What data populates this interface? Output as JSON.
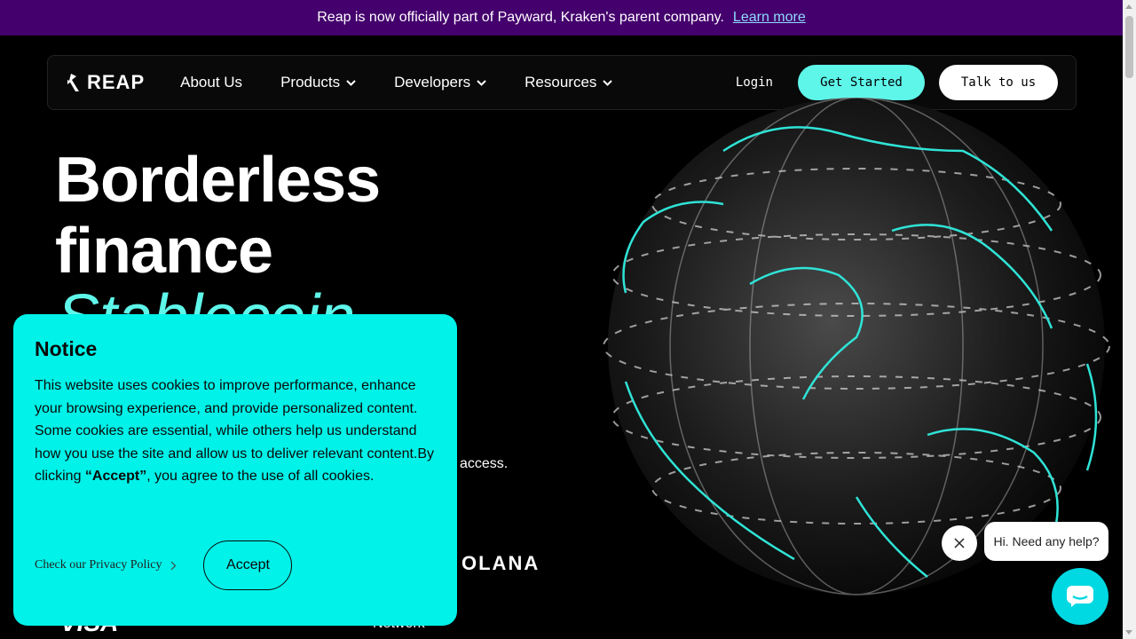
{
  "announcement": {
    "text": "Reap is now officially part of Payward, Kraken's parent company.",
    "link": "Learn more"
  },
  "nav": {
    "logo": "REAP",
    "items": [
      {
        "label": "About Us",
        "dropdown": false
      },
      {
        "label": "Products",
        "dropdown": true
      },
      {
        "label": "Developers",
        "dropdown": true
      },
      {
        "label": "Resources",
        "dropdown": true
      }
    ],
    "login": "Login",
    "get_started": "Get Started",
    "talk": "Talk to us"
  },
  "hero": {
    "line1": "Borderless",
    "line2": "finance",
    "accent": "Stablecoin",
    "subtitle_tail": "access.",
    "partners": {
      "solana": "OLANA",
      "visa": "VISA",
      "network": "Network"
    }
  },
  "cookie": {
    "title": "Notice",
    "body_pre": "This website uses cookies to improve performance, enhance your browsing experience, and provide personalized content. Some cookies are essential, while others help us understand how you use the site and allow us to deliver relevant content.By clicking ",
    "body_bold": "“Accept”",
    "body_post": ", you agree to the use of all cookies.",
    "privacy": "Check our Privacy Policy",
    "accept": "Accept"
  },
  "chat": {
    "bubble": "Hi. Need any help?"
  },
  "colors": {
    "announce_bg": "#44006d",
    "accent": "#5ff6ea",
    "cookie_bg": "#00f2e8",
    "chat": "#00d8e2"
  }
}
